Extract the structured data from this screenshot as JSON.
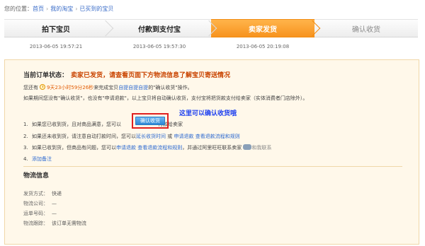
{
  "breadcrumb": {
    "prefix": "您的位置：",
    "items": [
      "首页",
      "我的淘宝",
      "已买到的宝贝"
    ]
  },
  "steps": [
    {
      "label": "拍下宝贝",
      "state": "done",
      "time": "2013-06-05 19:57:21"
    },
    {
      "label": "付款到支付宝",
      "state": "done",
      "time": "2013-06-05 19:57:30"
    },
    {
      "label": "卖家发货",
      "state": "active",
      "time": "2013-06-05 20:19:08"
    },
    {
      "label": "确认收货",
      "state": "pending",
      "time": ""
    }
  ],
  "order_status": {
    "label": "当前订单状态：",
    "text": "卖家已发货，请查看页面下方物流信息了解宝贝寄送情况"
  },
  "countdown_line": {
    "prefix": "您还有",
    "countdown": "9天23小时59分26秒",
    "middle": "来完成宝贝",
    "link": "自提自提自提",
    "suffix": "的\"确认收货\"操作。"
  },
  "auto_line": "如果期间您没有\"确认收货\"，也没有\"申请退款\"，以上宝贝将自动确认收货，支付宝将把货款支付给卖家（实体消费者门店除外）。",
  "hint": "这里可以确认收货哦",
  "items": [
    {
      "num": "1.",
      "text_a": "如果您已收到货，且对商品满意，您可以",
      "button": "确认收货",
      "text_b": "付款给卖家"
    },
    {
      "num": "2.",
      "text_a": "如果还未收到货，请注意自动打款时间，您可以",
      "link_a": "延长收货时间",
      "text_b": "或",
      "link_b": "申请退款",
      "link_c": "查看退款流程和规则"
    },
    {
      "num": "3.",
      "text_a": "如果已收到货，但商品有问题，您可以",
      "link_a": "申请退款",
      "link_b": "查看退款流程和规则",
      "text_b": "，并通过阿里旺旺联系卖家",
      "tag": "和我联系"
    },
    {
      "num": "4.",
      "link_a": "添加备注"
    }
  ],
  "logistics": {
    "title": "物流信息",
    "rows": [
      {
        "k": "发货方式：",
        "v": "快递"
      },
      {
        "k": "物流公司：",
        "v": "—"
      },
      {
        "k": "运单号码：",
        "v": "—"
      },
      {
        "k": "物流跟踪：",
        "v": "该订单无需物流"
      }
    ]
  },
  "colors": {
    "accent": "#f7931e",
    "link": "#2d6ad0",
    "hint": "#1b3ef0",
    "status": "#c94400",
    "highlight_box": "#e02020",
    "panel_bg": "#fff8ea"
  }
}
